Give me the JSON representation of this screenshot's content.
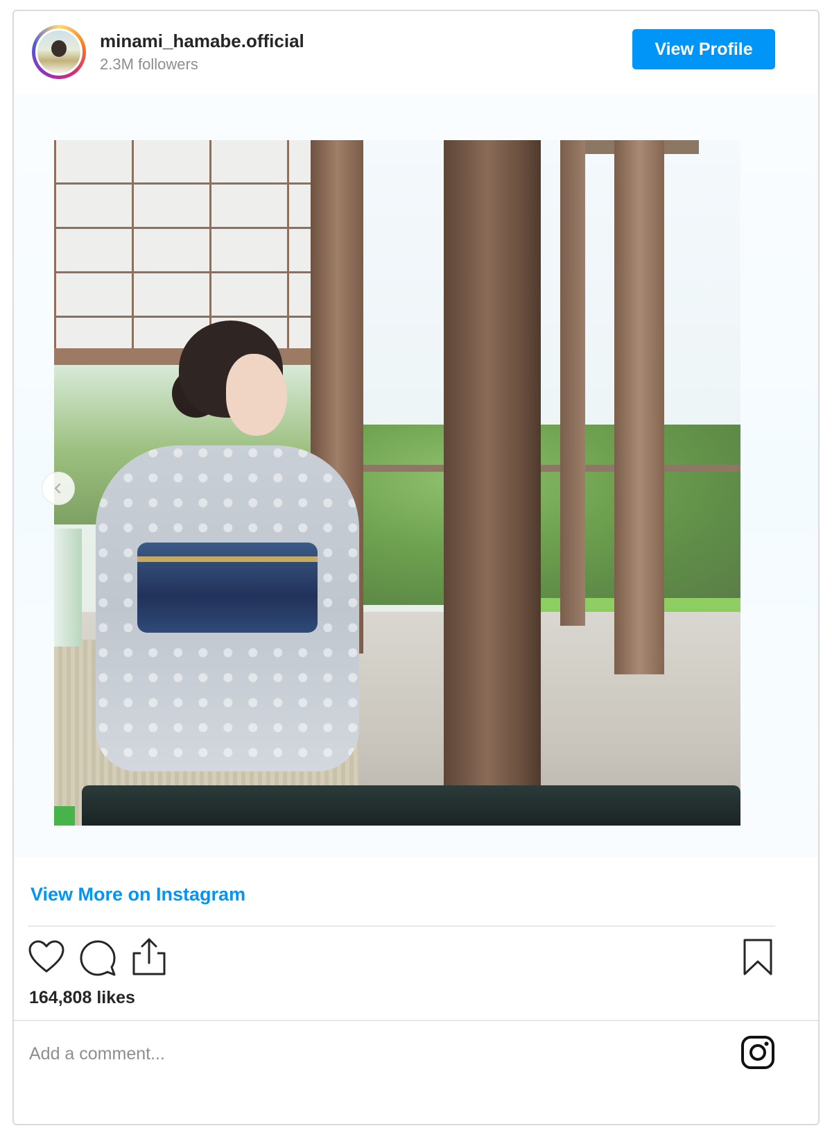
{
  "header": {
    "username": "minami_hamabe.official",
    "followers": "2.3M followers",
    "view_profile_label": "View Profile"
  },
  "media": {
    "prev_arrow_icon": "chevron-left-icon"
  },
  "footer": {
    "view_more_label": "View More on Instagram",
    "likes": "164,808 likes",
    "comment_placeholder": "Add a comment...",
    "icons": [
      "heart-icon",
      "comment-icon",
      "share-icon",
      "bookmark-icon",
      "instagram-logo-icon"
    ]
  },
  "colors": {
    "accent": "#0095f6",
    "text": "#262626",
    "muted": "#8e8e8e",
    "border": "#dbdbdb"
  }
}
